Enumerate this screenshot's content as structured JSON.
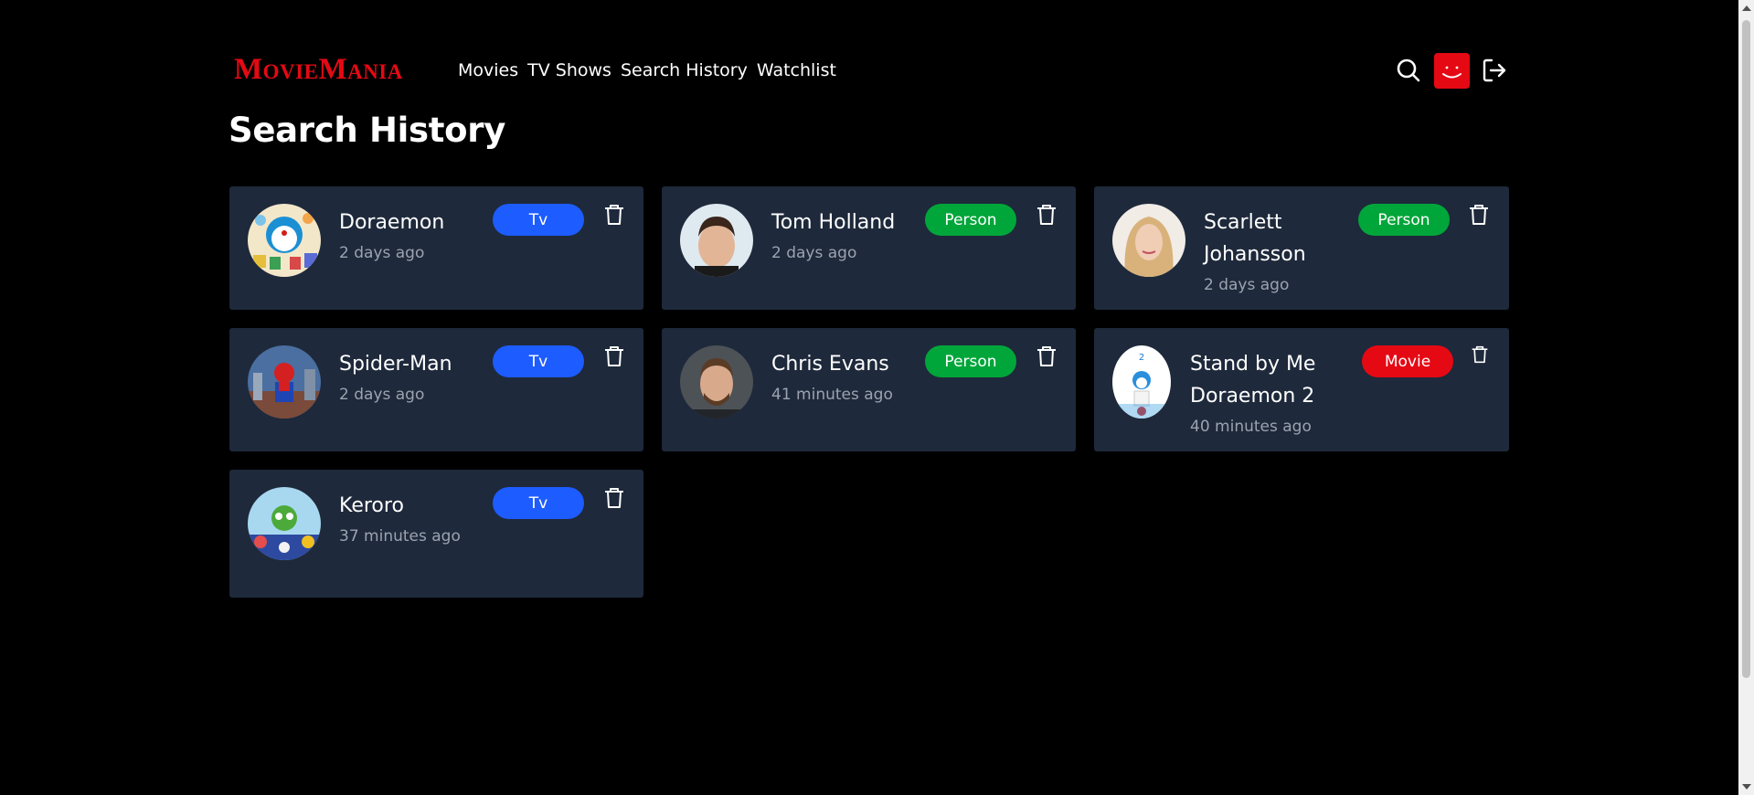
{
  "brand": {
    "name": "MovieMania",
    "color": "#e50914"
  },
  "nav": [
    {
      "label": "Movies"
    },
    {
      "label": "TV Shows"
    },
    {
      "label": "Search History"
    },
    {
      "label": "Watchlist"
    }
  ],
  "header_icons": {
    "search": "search-icon",
    "avatar": "avatar-smile-icon",
    "logout": "logout-icon"
  },
  "page": {
    "title": "Search History"
  },
  "history": [
    {
      "name": "Doraemon",
      "time": "2 days ago",
      "type": "Tv",
      "type_color": "#1d5cff"
    },
    {
      "name": "Tom Holland",
      "time": "2 days ago",
      "type": "Person",
      "type_color": "#01a63a"
    },
    {
      "name": "Scarlett Johansson",
      "time": "2 days ago",
      "type": "Person",
      "type_color": "#01a63a"
    },
    {
      "name": "Spider-Man",
      "time": "2 days ago",
      "type": "Tv",
      "type_color": "#1d5cff"
    },
    {
      "name": "Chris Evans",
      "time": "41 minutes ago",
      "type": "Person",
      "type_color": "#01a63a"
    },
    {
      "name": "Stand by Me Doraemon 2",
      "time": "40 minutes ago",
      "type": "Movie",
      "type_color": "#e50914"
    },
    {
      "name": "Keroro",
      "time": "37 minutes ago",
      "type": "Tv",
      "type_color": "#1d5cff"
    }
  ],
  "colors": {
    "card_bg": "#1e293b",
    "muted_text": "#9ca3af",
    "background": "#000000"
  }
}
